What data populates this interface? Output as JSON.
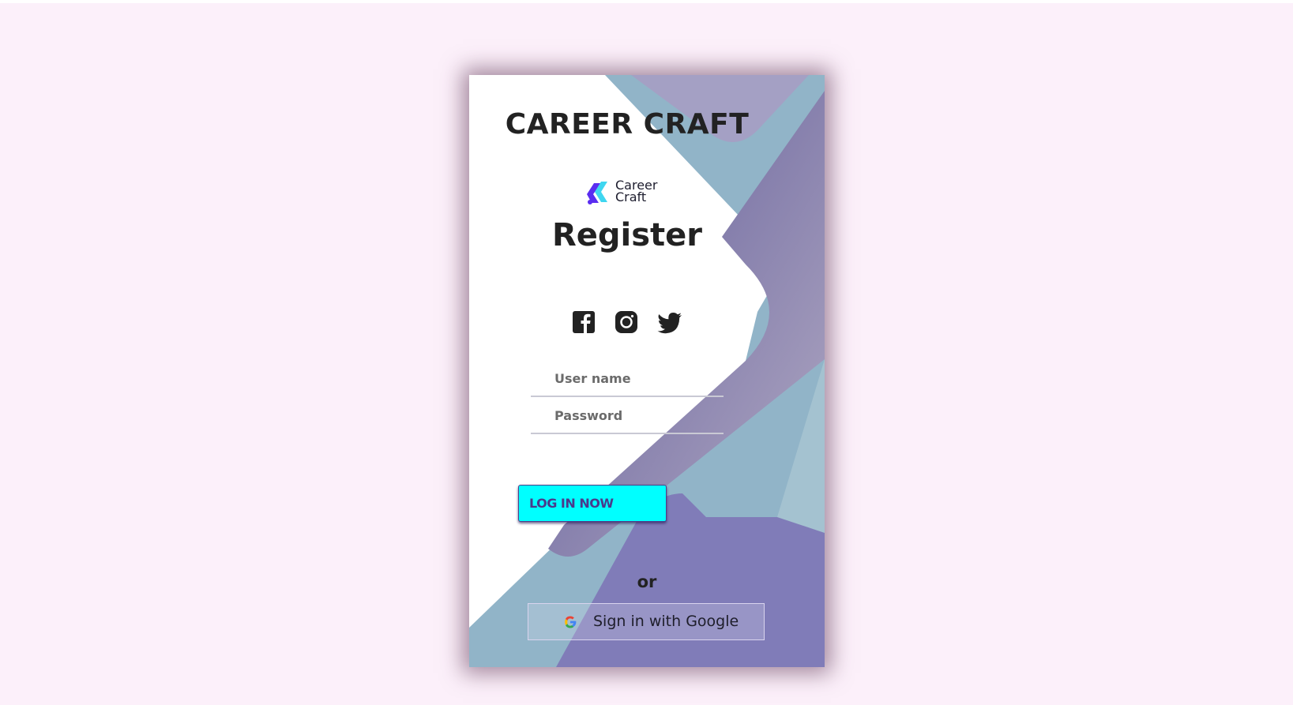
{
  "brand": {
    "title": "CAREER CRAFT",
    "logo_line1": "Career",
    "logo_line2": "Craft"
  },
  "form": {
    "heading": "Register",
    "username_placeholder": "User name",
    "password_placeholder": "Password",
    "login_label": "LOG IN NOW",
    "or_text": "or",
    "google_label": "Sign in with Google"
  },
  "social": {
    "items": [
      "facebook-icon",
      "instagram-icon",
      "twitter-icon"
    ]
  },
  "colors": {
    "page_background": "#fcf0fa",
    "login_button": "#00ffff",
    "login_text": "#4a3a8c",
    "shape_purple": "#7e79b8",
    "shape_blue": "#8fb4c8"
  }
}
